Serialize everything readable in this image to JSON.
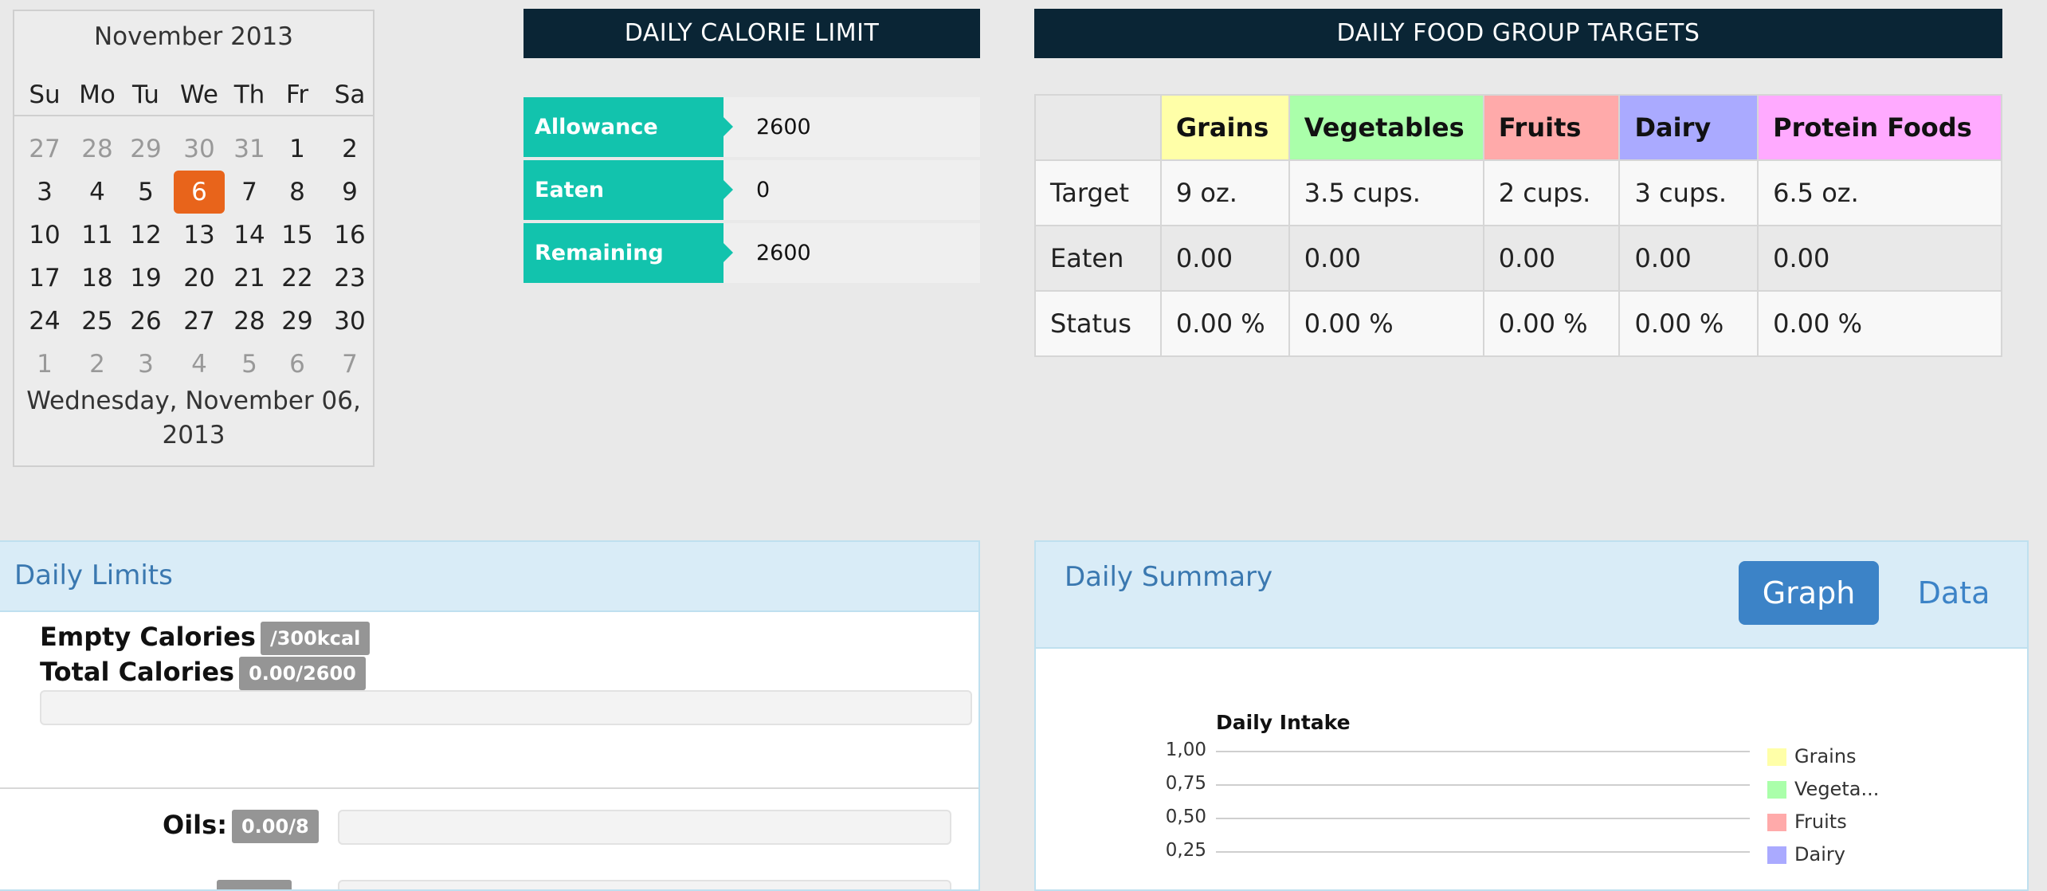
{
  "calendar": {
    "month_title": "November 2013",
    "weekdays": [
      "Su",
      "Mo",
      "Tu",
      "We",
      "Th",
      "Fr",
      "Sa"
    ],
    "weeks": [
      [
        {
          "d": "27",
          "o": true
        },
        {
          "d": "28",
          "o": true
        },
        {
          "d": "29",
          "o": true
        },
        {
          "d": "30",
          "o": true
        },
        {
          "d": "31",
          "o": true
        },
        {
          "d": "1"
        },
        {
          "d": "2"
        }
      ],
      [
        {
          "d": "3"
        },
        {
          "d": "4"
        },
        {
          "d": "5"
        },
        {
          "d": "6",
          "sel": true
        },
        {
          "d": "7"
        },
        {
          "d": "8"
        },
        {
          "d": "9"
        }
      ],
      [
        {
          "d": "10"
        },
        {
          "d": "11"
        },
        {
          "d": "12"
        },
        {
          "d": "13"
        },
        {
          "d": "14"
        },
        {
          "d": "15"
        },
        {
          "d": "16"
        }
      ],
      [
        {
          "d": "17"
        },
        {
          "d": "18"
        },
        {
          "d": "19"
        },
        {
          "d": "20"
        },
        {
          "d": "21"
        },
        {
          "d": "22"
        },
        {
          "d": "23"
        }
      ],
      [
        {
          "d": "24"
        },
        {
          "d": "25"
        },
        {
          "d": "26"
        },
        {
          "d": "27"
        },
        {
          "d": "28"
        },
        {
          "d": "29"
        },
        {
          "d": "30"
        }
      ],
      [
        {
          "d": "1",
          "o": true
        },
        {
          "d": "2",
          "o": true
        },
        {
          "d": "3",
          "o": true
        },
        {
          "d": "4",
          "o": true
        },
        {
          "d": "5",
          "o": true
        },
        {
          "d": "6",
          "o": true
        },
        {
          "d": "7",
          "o": true
        }
      ]
    ],
    "selected_date_line1": "Wednesday, November 06,",
    "selected_date_line2": "2013"
  },
  "calorie_limit": {
    "header": "DAILY CALORIE LIMIT",
    "rows": [
      {
        "label": "Allowance",
        "value": "2600"
      },
      {
        "label": "Eaten",
        "value": "0"
      },
      {
        "label": "Remaining",
        "value": "2600"
      }
    ]
  },
  "food_groups": {
    "header": "DAILY FOOD GROUP TARGETS",
    "columns": [
      {
        "name": "Grains",
        "color": "#ffffa8"
      },
      {
        "name": "Vegetables",
        "color": "#aaffaa"
      },
      {
        "name": "Fruits",
        "color": "#ffaaaa"
      },
      {
        "name": "Dairy",
        "color": "#aaaaff"
      },
      {
        "name": "Protein Foods",
        "color": "#ffaaff"
      }
    ],
    "rows": [
      {
        "label": "Target",
        "values": [
          "9 oz.",
          "3.5 cups.",
          "2 cups.",
          "3 cups.",
          "6.5 oz."
        ]
      },
      {
        "label": "Eaten",
        "values": [
          "0.00",
          "0.00",
          "0.00",
          "0.00",
          "0.00"
        ]
      },
      {
        "label": "Status",
        "values": [
          "0.00 %",
          "0.00 %",
          "0.00 %",
          "0.00 %",
          "0.00 %"
        ]
      }
    ]
  },
  "daily_limits": {
    "title": "Daily Limits",
    "empty_calories_label": "Empty Calories",
    "empty_calories_badge": "/300kcal",
    "total_calories_label": "Total Calories",
    "total_calories_badge": "0.00/2600",
    "total_calories_progress": 0,
    "oils_label": "Oils:",
    "oils_badge": "0.00/8",
    "oils_progress": 0
  },
  "daily_summary": {
    "title": "Daily Summary",
    "tabs": [
      {
        "label": "Graph",
        "active": true
      },
      {
        "label": "Data",
        "active": false
      }
    ]
  },
  "chart_data": {
    "type": "bar",
    "title": "Daily Intake",
    "categories": [
      "Grains",
      "Vegetables",
      "Fruits",
      "Dairy"
    ],
    "values": [
      0,
      0,
      0,
      0
    ],
    "colors": [
      "#ffffa8",
      "#aaffaa",
      "#ffaaaa",
      "#aaaaff"
    ],
    "y_ticks": [
      "1,00",
      "0,75",
      "0,50",
      "0,25"
    ],
    "ylim": [
      0,
      1
    ],
    "legend": [
      "Grains",
      "Vegeta...",
      "Fruits",
      "Dairy"
    ],
    "legend_position": "right",
    "grid": true
  }
}
